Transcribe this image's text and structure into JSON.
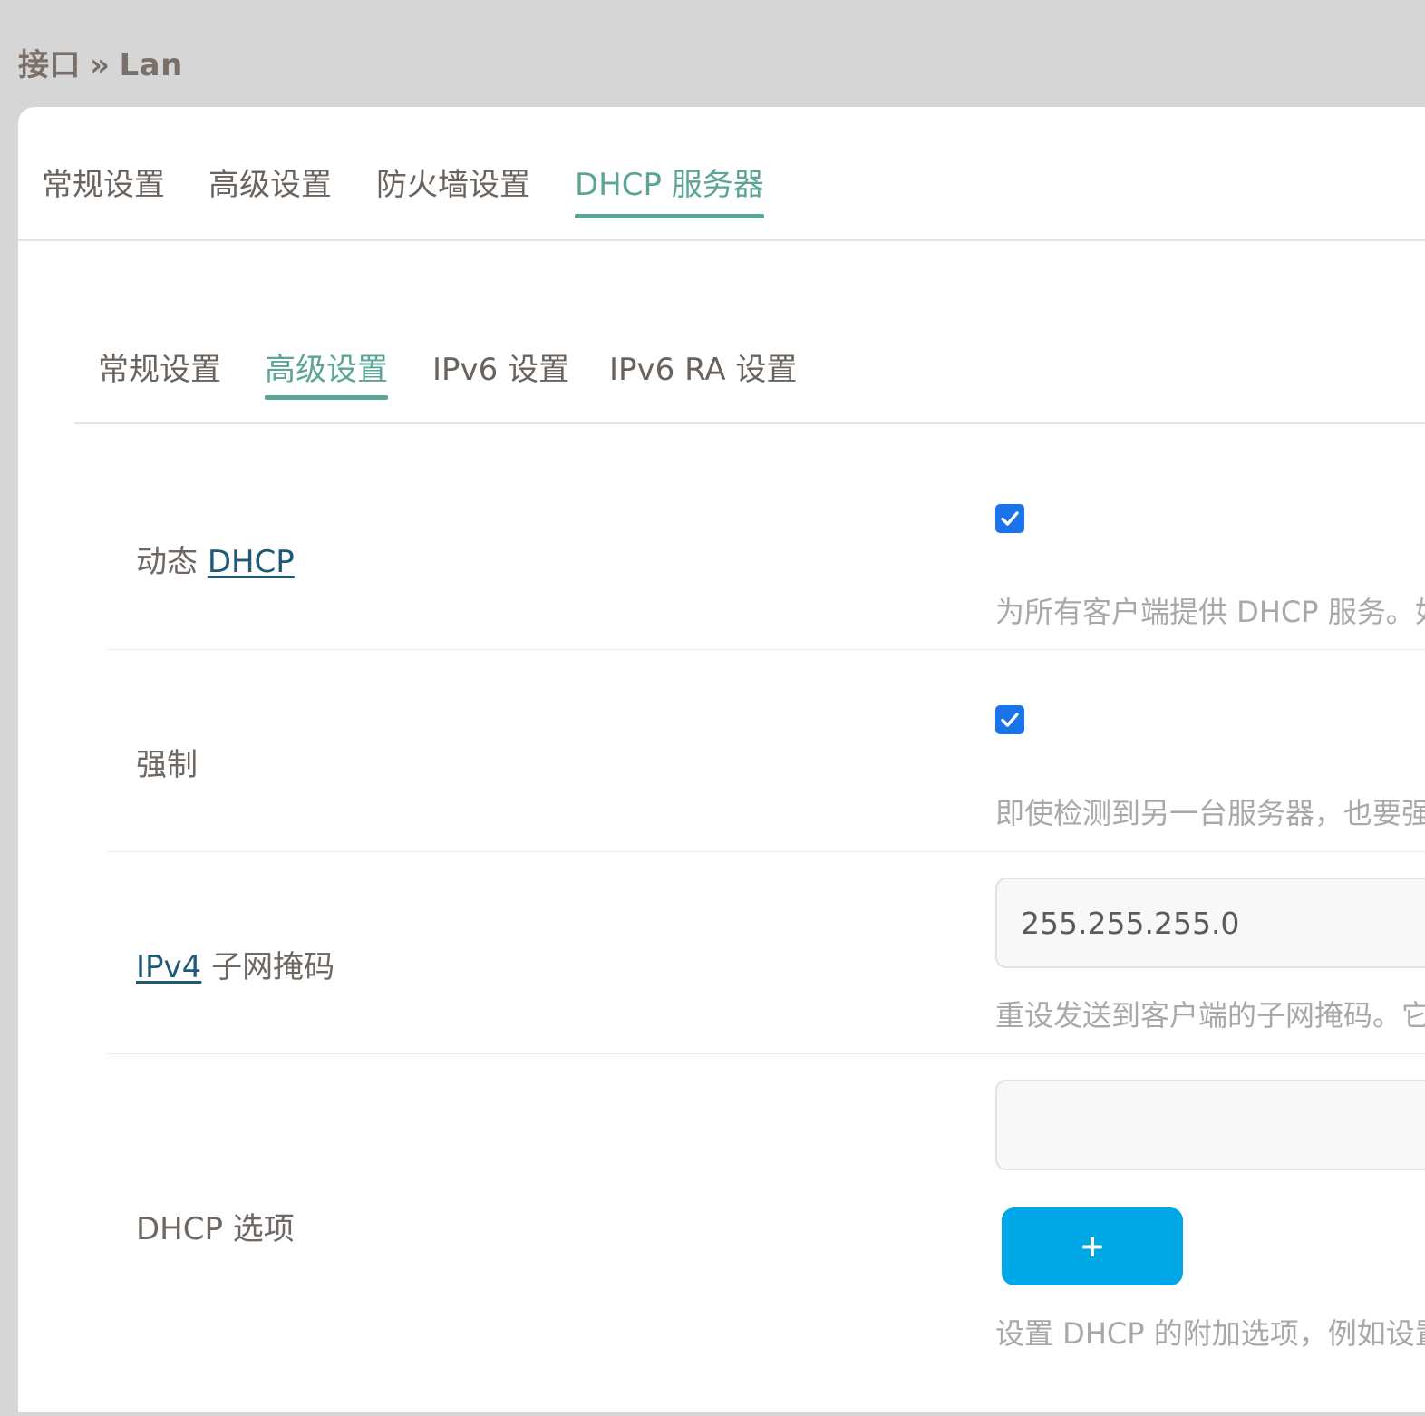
{
  "breadcrumb": {
    "parent": "接口",
    "separator": "»",
    "current": "Lan"
  },
  "main_tabs": [
    {
      "label": "常规设置",
      "active": false
    },
    {
      "label": "高级设置",
      "active": false
    },
    {
      "label": "防火墙设置",
      "active": false
    },
    {
      "label": "DHCP 服务器",
      "active": true
    }
  ],
  "sub_tabs": [
    {
      "label": "常规设置",
      "active": false
    },
    {
      "label": "高级设置",
      "active": true
    },
    {
      "label": "IPv6 设置",
      "active": false
    },
    {
      "label": "IPv6 RA 设置",
      "active": false
    }
  ],
  "fields": {
    "dynamic_dhcp": {
      "label_prefix": "动态",
      "label_link": "DHCP",
      "checked": true,
      "description": "为所有客户端提供 DHCP 服务。如"
    },
    "force": {
      "label": "强制",
      "checked": true,
      "description": "即使检测到另一台服务器，也要强"
    },
    "ipv4_netmask": {
      "label_link": "IPv4",
      "label_suffix": "子网掩码",
      "value": "255.255.255.0",
      "description": "重设发送到客户端的子网掩码。它"
    },
    "dhcp_options": {
      "label": "DHCP 选项",
      "value": "",
      "add_label": "+",
      "description": "设置 DHCP 的附加选项，例如设置"
    }
  },
  "colors": {
    "accent": "#5aa595",
    "checkbox": "#1a73e8",
    "add_button": "#00a7e6",
    "link": "#1e5a78"
  }
}
